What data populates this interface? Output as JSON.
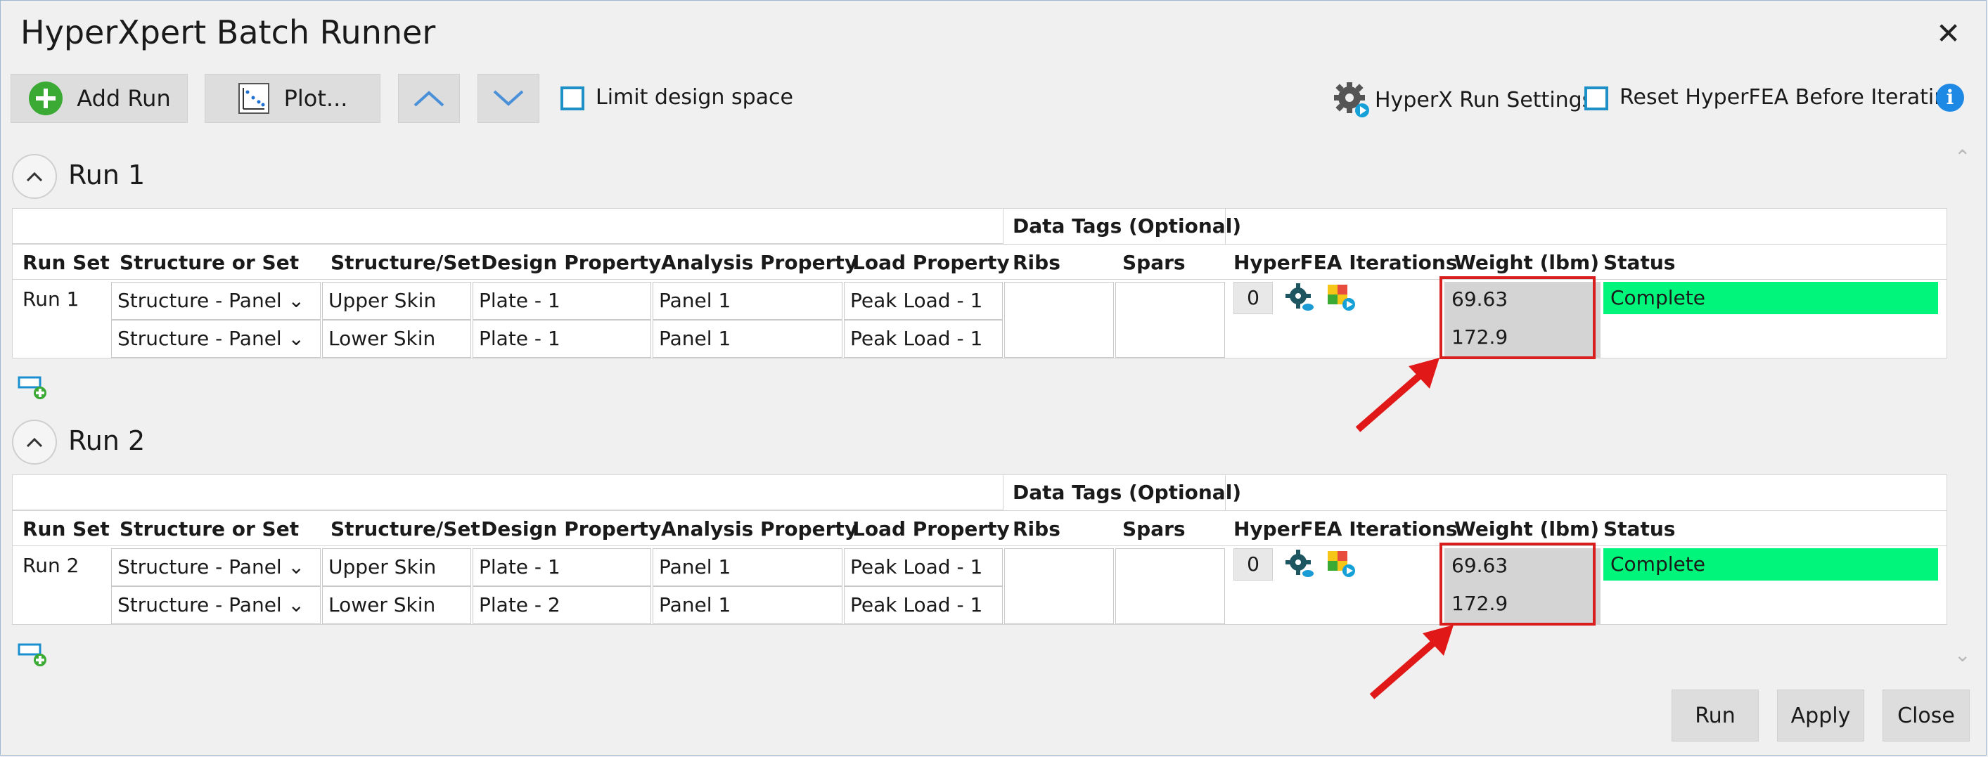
{
  "window": {
    "title": "HyperXpert Batch Runner"
  },
  "toolbar": {
    "add_run": "Add Run",
    "plot": "Plot...",
    "limit_design_space": "Limit design space",
    "run_settings": "HyperX Run Settings",
    "reset": "Reset HyperFEA Before Iterating"
  },
  "table": {
    "group_header": "Data Tags (Optional)",
    "columns": [
      "Run Set",
      "Structure or Set",
      "Structure/Set",
      "Design Property",
      "Analysis Property",
      "Load Property",
      "Ribs",
      "Spars",
      "HyperFEA Iterations",
      "Weight (lbm)",
      "Status"
    ]
  },
  "runs": [
    {
      "title": "Run 1",
      "run_set": "Run 1",
      "iterations": "0",
      "status": "Complete",
      "rows": [
        {
          "structure_or_set": "Structure - Panel",
          "structure": "Upper Skin",
          "design": "Plate - 1",
          "analysis": "Panel 1",
          "load": "Peak Load - 1",
          "weight": "69.63"
        },
        {
          "structure_or_set": "Structure - Panel",
          "structure": "Lower Skin",
          "design": "Plate - 1",
          "analysis": "Panel 1",
          "load": "Peak Load - 1",
          "weight": "172.9"
        }
      ]
    },
    {
      "title": "Run 2",
      "run_set": "Run 2",
      "iterations": "0",
      "status": "Complete",
      "rows": [
        {
          "structure_or_set": "Structure - Panel",
          "structure": "Upper Skin",
          "design": "Plate - 1",
          "analysis": "Panel 1",
          "load": "Peak Load - 1",
          "weight": "69.63"
        },
        {
          "structure_or_set": "Structure - Panel",
          "structure": "Lower Skin",
          "design": "Plate - 2",
          "analysis": "Panel 1",
          "load": "Peak Load - 1",
          "weight": "172.9"
        }
      ]
    }
  ],
  "footer": {
    "run": "Run",
    "apply": "Apply",
    "close": "Close"
  },
  "colors": {
    "status_complete": "#00f57a",
    "highlight": "#d91e1e",
    "accent": "#1e90c8"
  }
}
